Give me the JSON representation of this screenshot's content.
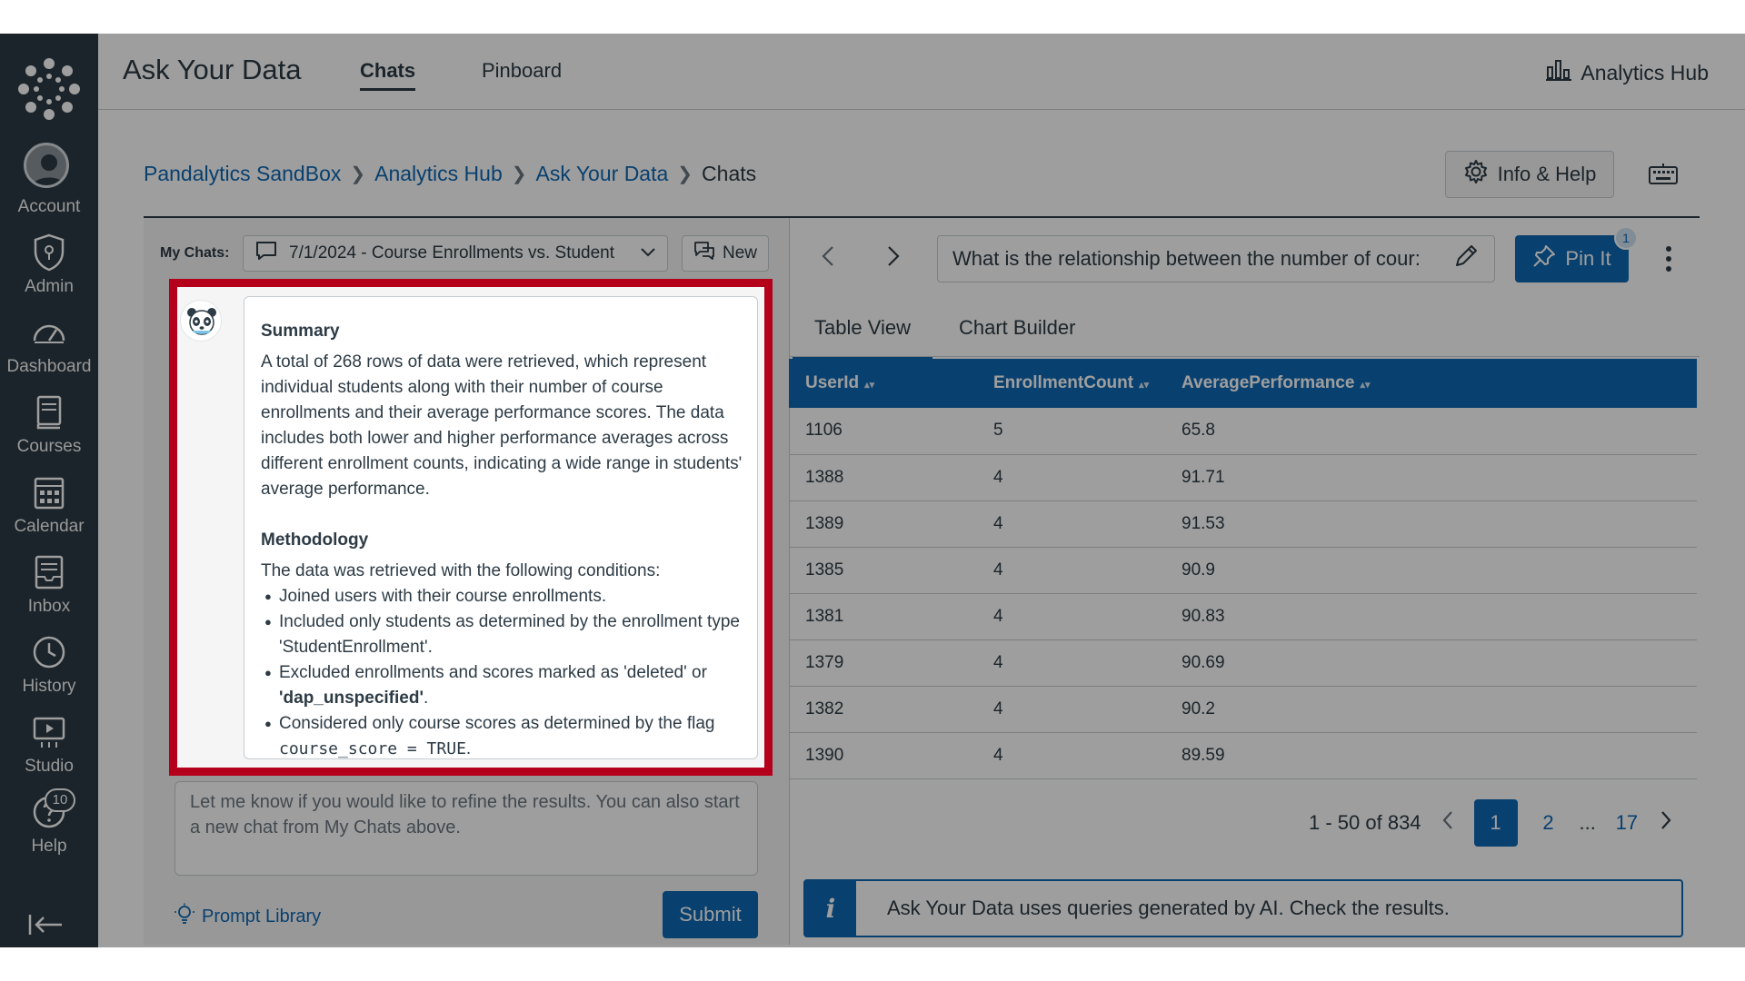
{
  "app": {
    "title": "Ask Your Data",
    "tabs": [
      {
        "label": "Chats",
        "active": true
      },
      {
        "label": "Pinboard",
        "active": false
      }
    ],
    "hub_link": "Analytics Hub"
  },
  "global_nav": {
    "items": [
      {
        "label": "Account",
        "icon": "account-icon"
      },
      {
        "label": "Admin",
        "icon": "shield-icon"
      },
      {
        "label": "Dashboard",
        "icon": "dashboard-icon"
      },
      {
        "label": "Courses",
        "icon": "book-icon"
      },
      {
        "label": "Calendar",
        "icon": "calendar-icon"
      },
      {
        "label": "Inbox",
        "icon": "inbox-icon"
      },
      {
        "label": "History",
        "icon": "clock-icon"
      },
      {
        "label": "Studio",
        "icon": "studio-icon"
      },
      {
        "label": "Help",
        "icon": "help-icon"
      }
    ],
    "help_badge": "10"
  },
  "breadcrumb": {
    "items": [
      "Pandalytics SandBox",
      "Analytics Hub",
      "Ask Your Data"
    ],
    "current": "Chats"
  },
  "info_help_label": "Info & Help",
  "my_chats": {
    "label": "My Chats:",
    "selected": "7/1/2024 - Course Enrollments vs. Student",
    "new_label": "New"
  },
  "message": {
    "summary_heading": "Summary",
    "summary_text": "A total of 268 rows of data were retrieved, which represent individual students along with their number of course enrollments and their average performance scores. The data includes both lower and higher performance averages across different enrollment counts, indicating a wide range in students' average performance.",
    "methodology_heading": "Methodology",
    "methodology_intro": "The data was retrieved with the following conditions:",
    "bullet1": "Joined users with their course enrollments.",
    "bullet2": "Included only students as determined by the enrollment type 'StudentEnrollment'.",
    "bullet3_pre": "Excluded enrollments and scores marked as 'deleted' or ",
    "bullet3_bold": "'dap_unspecified'",
    "bullet3_post": ".",
    "bullet4_pre": "Considered only course scores as determined by the flag",
    "bullet4_code": "course_score = TRUE",
    "bullet4_post": "."
  },
  "followup_text": "Let me know if you would like to refine the results.  You can also start a new chat from My Chats above.",
  "prompt_library_label": "Prompt Library",
  "submit_label": "Submit",
  "question": {
    "value": "What is the relationship between the number of cour:"
  },
  "pin": {
    "label": "Pin It",
    "badge": "1"
  },
  "view_tabs": [
    {
      "label": "Table View",
      "active": true
    },
    {
      "label": "Chart Builder",
      "active": false
    }
  ],
  "table": {
    "columns": [
      "UserId",
      "EnrollmentCount",
      "AveragePerformance"
    ],
    "rows": [
      [
        "1106",
        "5",
        "65.8"
      ],
      [
        "1388",
        "4",
        "91.71"
      ],
      [
        "1389",
        "4",
        "91.53"
      ],
      [
        "1385",
        "4",
        "90.9"
      ],
      [
        "1381",
        "4",
        "90.83"
      ],
      [
        "1379",
        "4",
        "90.69"
      ],
      [
        "1382",
        "4",
        "90.2"
      ],
      [
        "1390",
        "4",
        "89.59"
      ]
    ]
  },
  "pagination": {
    "range": "1 - 50 of 834",
    "pages": [
      "1",
      "2",
      "...",
      "17"
    ],
    "current": "1"
  },
  "ai_notice": "Ask Your Data uses queries generated by AI. Check the results.",
  "colors": {
    "nav_bg": "#2d3b45",
    "accent": "#0e68b3",
    "highlight": "#b5001b"
  }
}
